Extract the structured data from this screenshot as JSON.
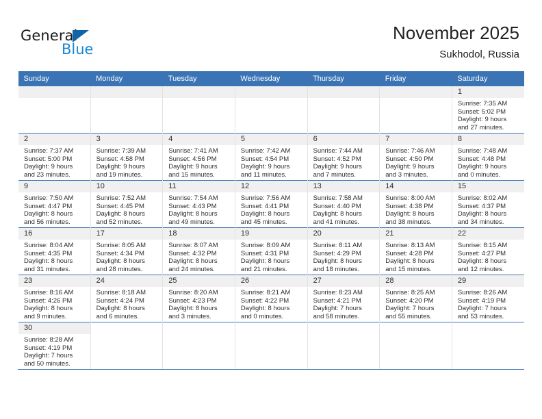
{
  "brand": {
    "name_top": "General",
    "name_bottom": "Blue",
    "color_dark": "#1263a8",
    "color_light": "#1786d4"
  },
  "header": {
    "title": "November 2025",
    "subtitle": "Sukhodol, Russia"
  },
  "theme": {
    "header_bg": "#3b74b5",
    "daynum_bg": "#f0f0f0",
    "grid_line": "#3b74b5"
  },
  "weekday_headers": [
    "Sunday",
    "Monday",
    "Tuesday",
    "Wednesday",
    "Thursday",
    "Friday",
    "Saturday"
  ],
  "weeks": [
    [
      {
        "day": "",
        "empty": true,
        "blank": true,
        "lines": []
      },
      {
        "day": "",
        "empty": true,
        "blank": true,
        "lines": []
      },
      {
        "day": "",
        "empty": true,
        "blank": true,
        "lines": []
      },
      {
        "day": "",
        "empty": true,
        "blank": true,
        "lines": []
      },
      {
        "day": "",
        "empty": true,
        "blank": true,
        "lines": []
      },
      {
        "day": "",
        "empty": true,
        "blank": true,
        "lines": []
      },
      {
        "day": "1",
        "sunrise": "Sunrise: 7:35 AM",
        "sunset": "Sunset: 5:02 PM",
        "daylight1": "Daylight: 9 hours",
        "daylight2": "and 27 minutes."
      }
    ],
    [
      {
        "day": "2",
        "sunrise": "Sunrise: 7:37 AM",
        "sunset": "Sunset: 5:00 PM",
        "daylight1": "Daylight: 9 hours",
        "daylight2": "and 23 minutes."
      },
      {
        "day": "3",
        "sunrise": "Sunrise: 7:39 AM",
        "sunset": "Sunset: 4:58 PM",
        "daylight1": "Daylight: 9 hours",
        "daylight2": "and 19 minutes."
      },
      {
        "day": "4",
        "sunrise": "Sunrise: 7:41 AM",
        "sunset": "Sunset: 4:56 PM",
        "daylight1": "Daylight: 9 hours",
        "daylight2": "and 15 minutes."
      },
      {
        "day": "5",
        "sunrise": "Sunrise: 7:42 AM",
        "sunset": "Sunset: 4:54 PM",
        "daylight1": "Daylight: 9 hours",
        "daylight2": "and 11 minutes."
      },
      {
        "day": "6",
        "sunrise": "Sunrise: 7:44 AM",
        "sunset": "Sunset: 4:52 PM",
        "daylight1": "Daylight: 9 hours",
        "daylight2": "and 7 minutes."
      },
      {
        "day": "7",
        "sunrise": "Sunrise: 7:46 AM",
        "sunset": "Sunset: 4:50 PM",
        "daylight1": "Daylight: 9 hours",
        "daylight2": "and 3 minutes."
      },
      {
        "day": "8",
        "sunrise": "Sunrise: 7:48 AM",
        "sunset": "Sunset: 4:48 PM",
        "daylight1": "Daylight: 9 hours",
        "daylight2": "and 0 minutes."
      }
    ],
    [
      {
        "day": "9",
        "sunrise": "Sunrise: 7:50 AM",
        "sunset": "Sunset: 4:47 PM",
        "daylight1": "Daylight: 8 hours",
        "daylight2": "and 56 minutes."
      },
      {
        "day": "10",
        "sunrise": "Sunrise: 7:52 AM",
        "sunset": "Sunset: 4:45 PM",
        "daylight1": "Daylight: 8 hours",
        "daylight2": "and 52 minutes."
      },
      {
        "day": "11",
        "sunrise": "Sunrise: 7:54 AM",
        "sunset": "Sunset: 4:43 PM",
        "daylight1": "Daylight: 8 hours",
        "daylight2": "and 49 minutes."
      },
      {
        "day": "12",
        "sunrise": "Sunrise: 7:56 AM",
        "sunset": "Sunset: 4:41 PM",
        "daylight1": "Daylight: 8 hours",
        "daylight2": "and 45 minutes."
      },
      {
        "day": "13",
        "sunrise": "Sunrise: 7:58 AM",
        "sunset": "Sunset: 4:40 PM",
        "daylight1": "Daylight: 8 hours",
        "daylight2": "and 41 minutes."
      },
      {
        "day": "14",
        "sunrise": "Sunrise: 8:00 AM",
        "sunset": "Sunset: 4:38 PM",
        "daylight1": "Daylight: 8 hours",
        "daylight2": "and 38 minutes."
      },
      {
        "day": "15",
        "sunrise": "Sunrise: 8:02 AM",
        "sunset": "Sunset: 4:37 PM",
        "daylight1": "Daylight: 8 hours",
        "daylight2": "and 34 minutes."
      }
    ],
    [
      {
        "day": "16",
        "sunrise": "Sunrise: 8:04 AM",
        "sunset": "Sunset: 4:35 PM",
        "daylight1": "Daylight: 8 hours",
        "daylight2": "and 31 minutes."
      },
      {
        "day": "17",
        "sunrise": "Sunrise: 8:05 AM",
        "sunset": "Sunset: 4:34 PM",
        "daylight1": "Daylight: 8 hours",
        "daylight2": "and 28 minutes."
      },
      {
        "day": "18",
        "sunrise": "Sunrise: 8:07 AM",
        "sunset": "Sunset: 4:32 PM",
        "daylight1": "Daylight: 8 hours",
        "daylight2": "and 24 minutes."
      },
      {
        "day": "19",
        "sunrise": "Sunrise: 8:09 AM",
        "sunset": "Sunset: 4:31 PM",
        "daylight1": "Daylight: 8 hours",
        "daylight2": "and 21 minutes."
      },
      {
        "day": "20",
        "sunrise": "Sunrise: 8:11 AM",
        "sunset": "Sunset: 4:29 PM",
        "daylight1": "Daylight: 8 hours",
        "daylight2": "and 18 minutes."
      },
      {
        "day": "21",
        "sunrise": "Sunrise: 8:13 AM",
        "sunset": "Sunset: 4:28 PM",
        "daylight1": "Daylight: 8 hours",
        "daylight2": "and 15 minutes."
      },
      {
        "day": "22",
        "sunrise": "Sunrise: 8:15 AM",
        "sunset": "Sunset: 4:27 PM",
        "daylight1": "Daylight: 8 hours",
        "daylight2": "and 12 minutes."
      }
    ],
    [
      {
        "day": "23",
        "sunrise": "Sunrise: 8:16 AM",
        "sunset": "Sunset: 4:26 PM",
        "daylight1": "Daylight: 8 hours",
        "daylight2": "and 9 minutes."
      },
      {
        "day": "24",
        "sunrise": "Sunrise: 8:18 AM",
        "sunset": "Sunset: 4:24 PM",
        "daylight1": "Daylight: 8 hours",
        "daylight2": "and 6 minutes."
      },
      {
        "day": "25",
        "sunrise": "Sunrise: 8:20 AM",
        "sunset": "Sunset: 4:23 PM",
        "daylight1": "Daylight: 8 hours",
        "daylight2": "and 3 minutes."
      },
      {
        "day": "26",
        "sunrise": "Sunrise: 8:21 AM",
        "sunset": "Sunset: 4:22 PM",
        "daylight1": "Daylight: 8 hours",
        "daylight2": "and 0 minutes."
      },
      {
        "day": "27",
        "sunrise": "Sunrise: 8:23 AM",
        "sunset": "Sunset: 4:21 PM",
        "daylight1": "Daylight: 7 hours",
        "daylight2": "and 58 minutes."
      },
      {
        "day": "28",
        "sunrise": "Sunrise: 8:25 AM",
        "sunset": "Sunset: 4:20 PM",
        "daylight1": "Daylight: 7 hours",
        "daylight2": "and 55 minutes."
      },
      {
        "day": "29",
        "sunrise": "Sunrise: 8:26 AM",
        "sunset": "Sunset: 4:19 PM",
        "daylight1": "Daylight: 7 hours",
        "daylight2": "and 53 minutes."
      }
    ],
    [
      {
        "day": "30",
        "sunrise": "Sunrise: 8:28 AM",
        "sunset": "Sunset: 4:19 PM",
        "daylight1": "Daylight: 7 hours",
        "daylight2": "and 50 minutes."
      },
      {
        "day": "",
        "empty": true,
        "blank": true,
        "lines": []
      },
      {
        "day": "",
        "empty": true,
        "blank": true,
        "lines": []
      },
      {
        "day": "",
        "empty": true,
        "blank": true,
        "lines": []
      },
      {
        "day": "",
        "empty": true,
        "blank": true,
        "lines": []
      },
      {
        "day": "",
        "empty": true,
        "blank": true,
        "lines": []
      },
      {
        "day": "",
        "empty": true,
        "blank": true,
        "lines": []
      }
    ]
  ]
}
